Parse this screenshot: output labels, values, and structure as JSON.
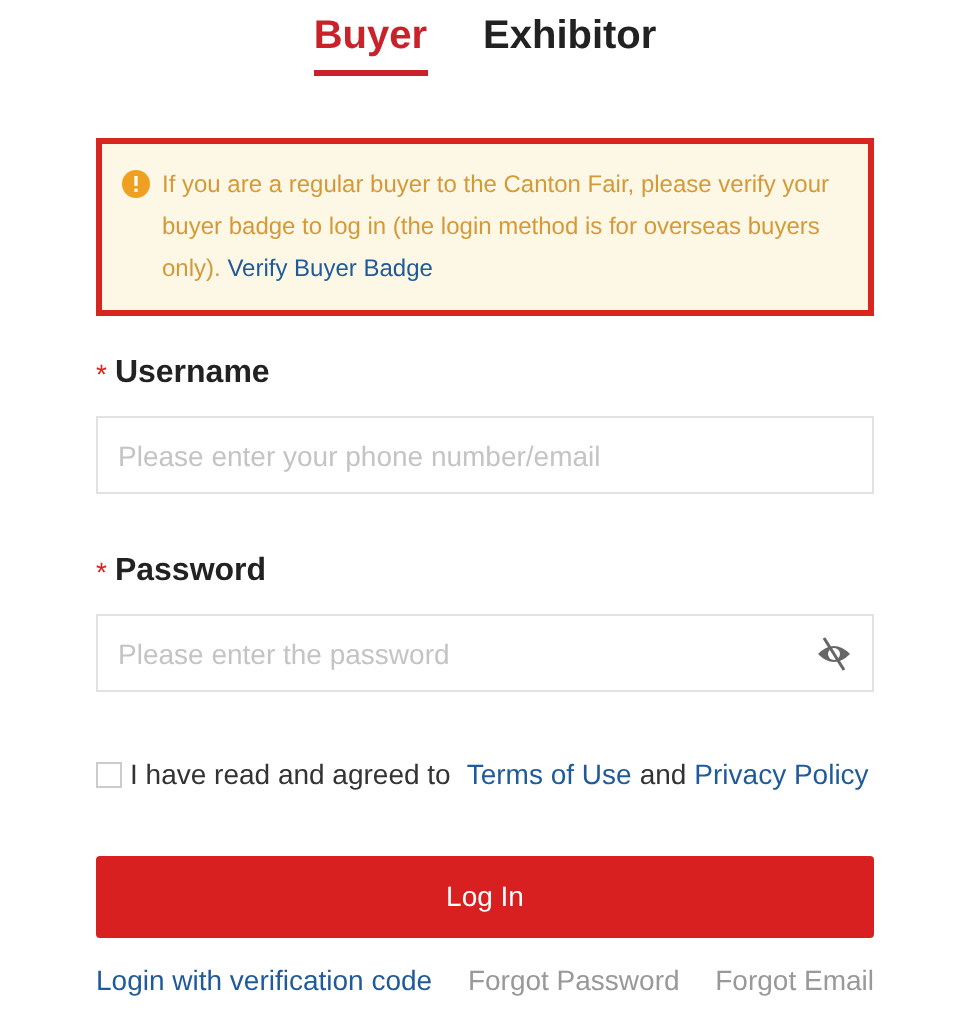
{
  "tabs": [
    {
      "label": "Buyer",
      "selected": true
    },
    {
      "label": "Exhibitor",
      "selected": false
    }
  ],
  "notice": {
    "text": "If you are a regular buyer to the Canton Fair, please verify your buyer badge to log in (the login method is for overseas buyers only).",
    "link": "Verify Buyer Badge"
  },
  "fields": [
    {
      "label": "Username",
      "required_mark": "*",
      "placeholder": "Please enter your phone number/email",
      "kind": "text"
    },
    {
      "label": "Password",
      "required_mark": "*",
      "placeholder": "Please enter the password",
      "kind": "password"
    }
  ],
  "agreement": {
    "checked": false,
    "text": "I have read and agreed to",
    "link_1": "Terms of Use",
    "joiner": "and",
    "link_2": "Privacy Policy"
  },
  "login_button": "Log In",
  "links": [
    {
      "label": "Login with verification code",
      "kind": "primary"
    },
    {
      "label": "Forgot Password",
      "kind": "muted"
    },
    {
      "label": "Forgot Email",
      "kind": "muted"
    }
  ]
}
